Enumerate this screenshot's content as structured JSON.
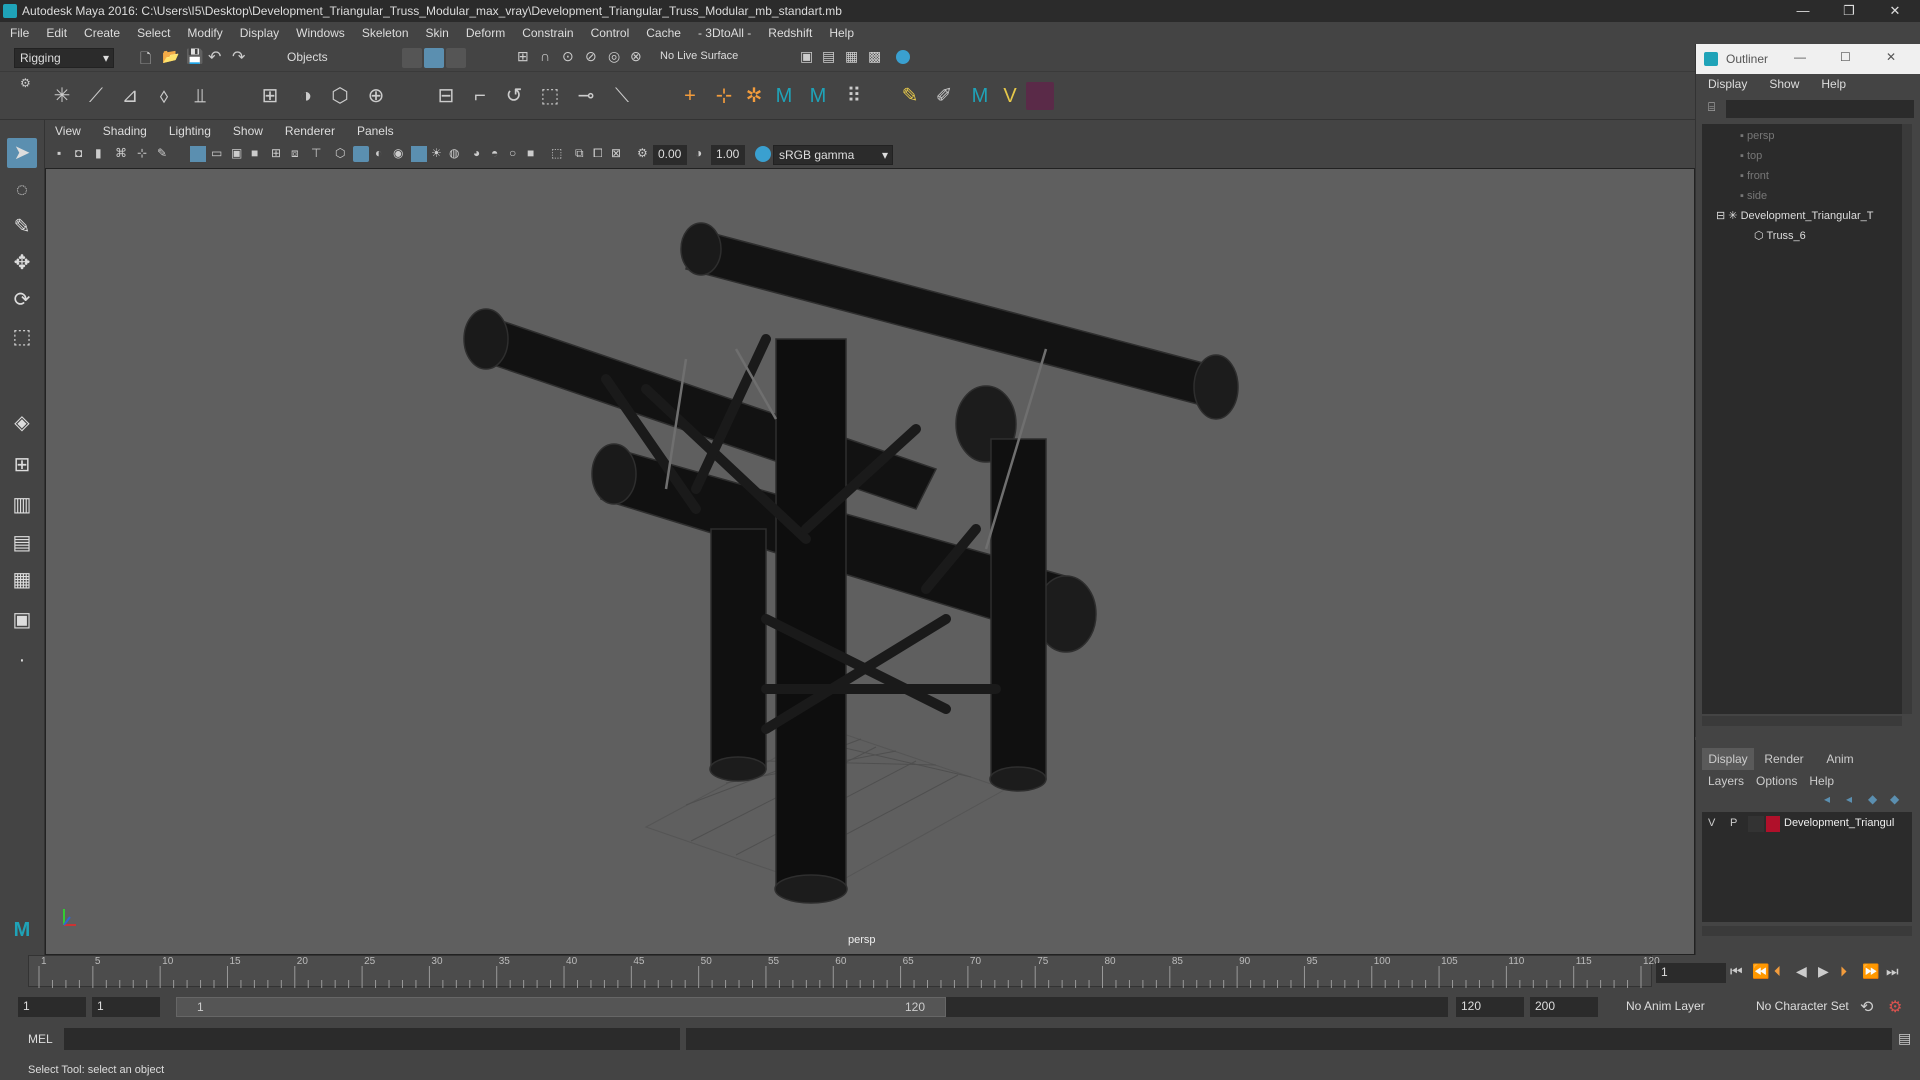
{
  "window": {
    "title": "Autodesk Maya 2016: C:\\Users\\I5\\Desktop\\Development_Triangular_Truss_Modular_max_vray\\Development_Triangular_Truss_Modular_mb_standart.mb",
    "minimize_glyph": "—",
    "restore_glyph": "❐",
    "close_glyph": "✕"
  },
  "menubar": [
    "File",
    "Edit",
    "Create",
    "Select",
    "Modify",
    "Display",
    "Windows",
    "Skeleton",
    "Skin",
    "Deform",
    "Constrain",
    "Control",
    "Cache",
    "- 3DtoAll -",
    "Redshift",
    "Help"
  ],
  "statusline": {
    "menuset": "Rigging",
    "selection_mode": "Objects",
    "live_surface": "No Live Surface"
  },
  "viewport": {
    "menu": [
      "View",
      "Shading",
      "Lighting",
      "Show",
      "Renderer",
      "Panels"
    ],
    "field1": "0.00",
    "field2": "1.00",
    "color_space": "sRGB gamma",
    "camera_label": "persp"
  },
  "outliner": {
    "title": "Outliner",
    "menu": [
      "Display",
      "Show",
      "Help"
    ],
    "items": [
      {
        "label": "persp",
        "dim": true
      },
      {
        "label": "top",
        "dim": true
      },
      {
        "label": "front",
        "dim": true
      },
      {
        "label": "side",
        "dim": true
      },
      {
        "label": "Development_Triangular_T",
        "dim": false
      },
      {
        "label": "Truss_6",
        "dim": false
      }
    ]
  },
  "layers": {
    "tabs": [
      "Display",
      "Render",
      "Anim"
    ],
    "menu": [
      "Layers",
      "Options",
      "Help"
    ],
    "layer": {
      "v": "V",
      "p": "P",
      "name": "Development_Triangul",
      "color": "#b0102a"
    }
  },
  "timeline": {
    "ticks": [
      "1",
      "5",
      "10",
      "15",
      "20",
      "25",
      "30",
      "35",
      "40",
      "45",
      "50",
      "55",
      "60",
      "65",
      "70",
      "75",
      "80",
      "85",
      "90",
      "95",
      "100",
      "105",
      "110",
      "115",
      "120"
    ],
    "current_frame": "1"
  },
  "range": {
    "start": "1",
    "inner_start": "1",
    "slider_start": "1",
    "slider_end": "120",
    "end": "120",
    "max_end": "200",
    "anim_layer": "No Anim Layer",
    "character_set": "No Character Set"
  },
  "cmd": {
    "lang": "MEL"
  },
  "help": {
    "text": "Select Tool: select an object"
  }
}
